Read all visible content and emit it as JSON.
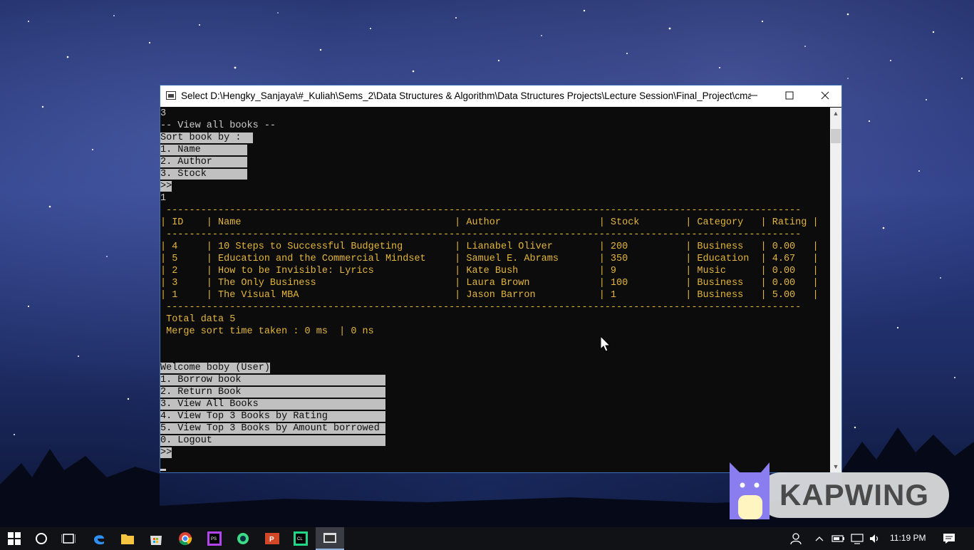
{
  "window": {
    "title": "Select D:\\Hengky_Sanjaya\\#_Kuliah\\Sems_2\\Data Structures & Algorithm\\Data Structures Projects\\Lecture Session\\Final_Project\\cmake-b...",
    "minimize_label": "—",
    "maximize_label": "☐",
    "close_label": "✕"
  },
  "console": {
    "l1": "3",
    "l2": "-- View all books --",
    "sort_menu": [
      "Sort book by :",
      "1. Name",
      "2. Author",
      "3. Stock"
    ],
    "prompt1": ">>",
    "input1": "1",
    "table_rule": " --------------------------------------------------------------------------------------------------------------",
    "table_header": "| ID    | Name                                     | Author                 | Stock        | Category   | Rating |",
    "table_rows": [
      "| 4     | 10 Steps to Successful Budgeting         | Lianabel Oliver        | 200          | Business   | 0.00   |",
      "| 5     | Education and the Commercial Mindset     | Samuel E. Abrams       | 350          | Education  | 4.67   |",
      "| 2     | How to be Invisible: Lyrics              | Kate Bush              | 9            | Music      | 0.00   |",
      "| 3     | The Only Business                        | Laura Brown            | 100          | Business   | 0.00   |",
      "| 1     | The Visual MBA                           | Jason Barron           | 1            | Business   | 5.00   |"
    ],
    "total": " Total data 5",
    "merge": " Merge sort time taken : 0 ms  | 0 ns",
    "welcome": "Welcome boby (User)",
    "user_menu": [
      "1. Borrow book",
      "2. Return Book",
      "3. View All Books",
      "4. View Top 3 Books by Rating",
      "5. View Top 3 Books by Amount borrowed",
      "0. Logout"
    ],
    "prompt2": ">>"
  },
  "watermark": {
    "text": "KAPWING"
  },
  "taskbar": {
    "clock": "11:19 PM",
    "icons": [
      "start-icon",
      "cortana-icon",
      "task-view-icon",
      "edge-icon",
      "file-explorer-icon",
      "store-icon",
      "chrome-icon",
      "phpstorm-icon",
      "android-studio-icon",
      "powerpoint-icon",
      "clion-icon",
      "console-icon"
    ]
  }
}
